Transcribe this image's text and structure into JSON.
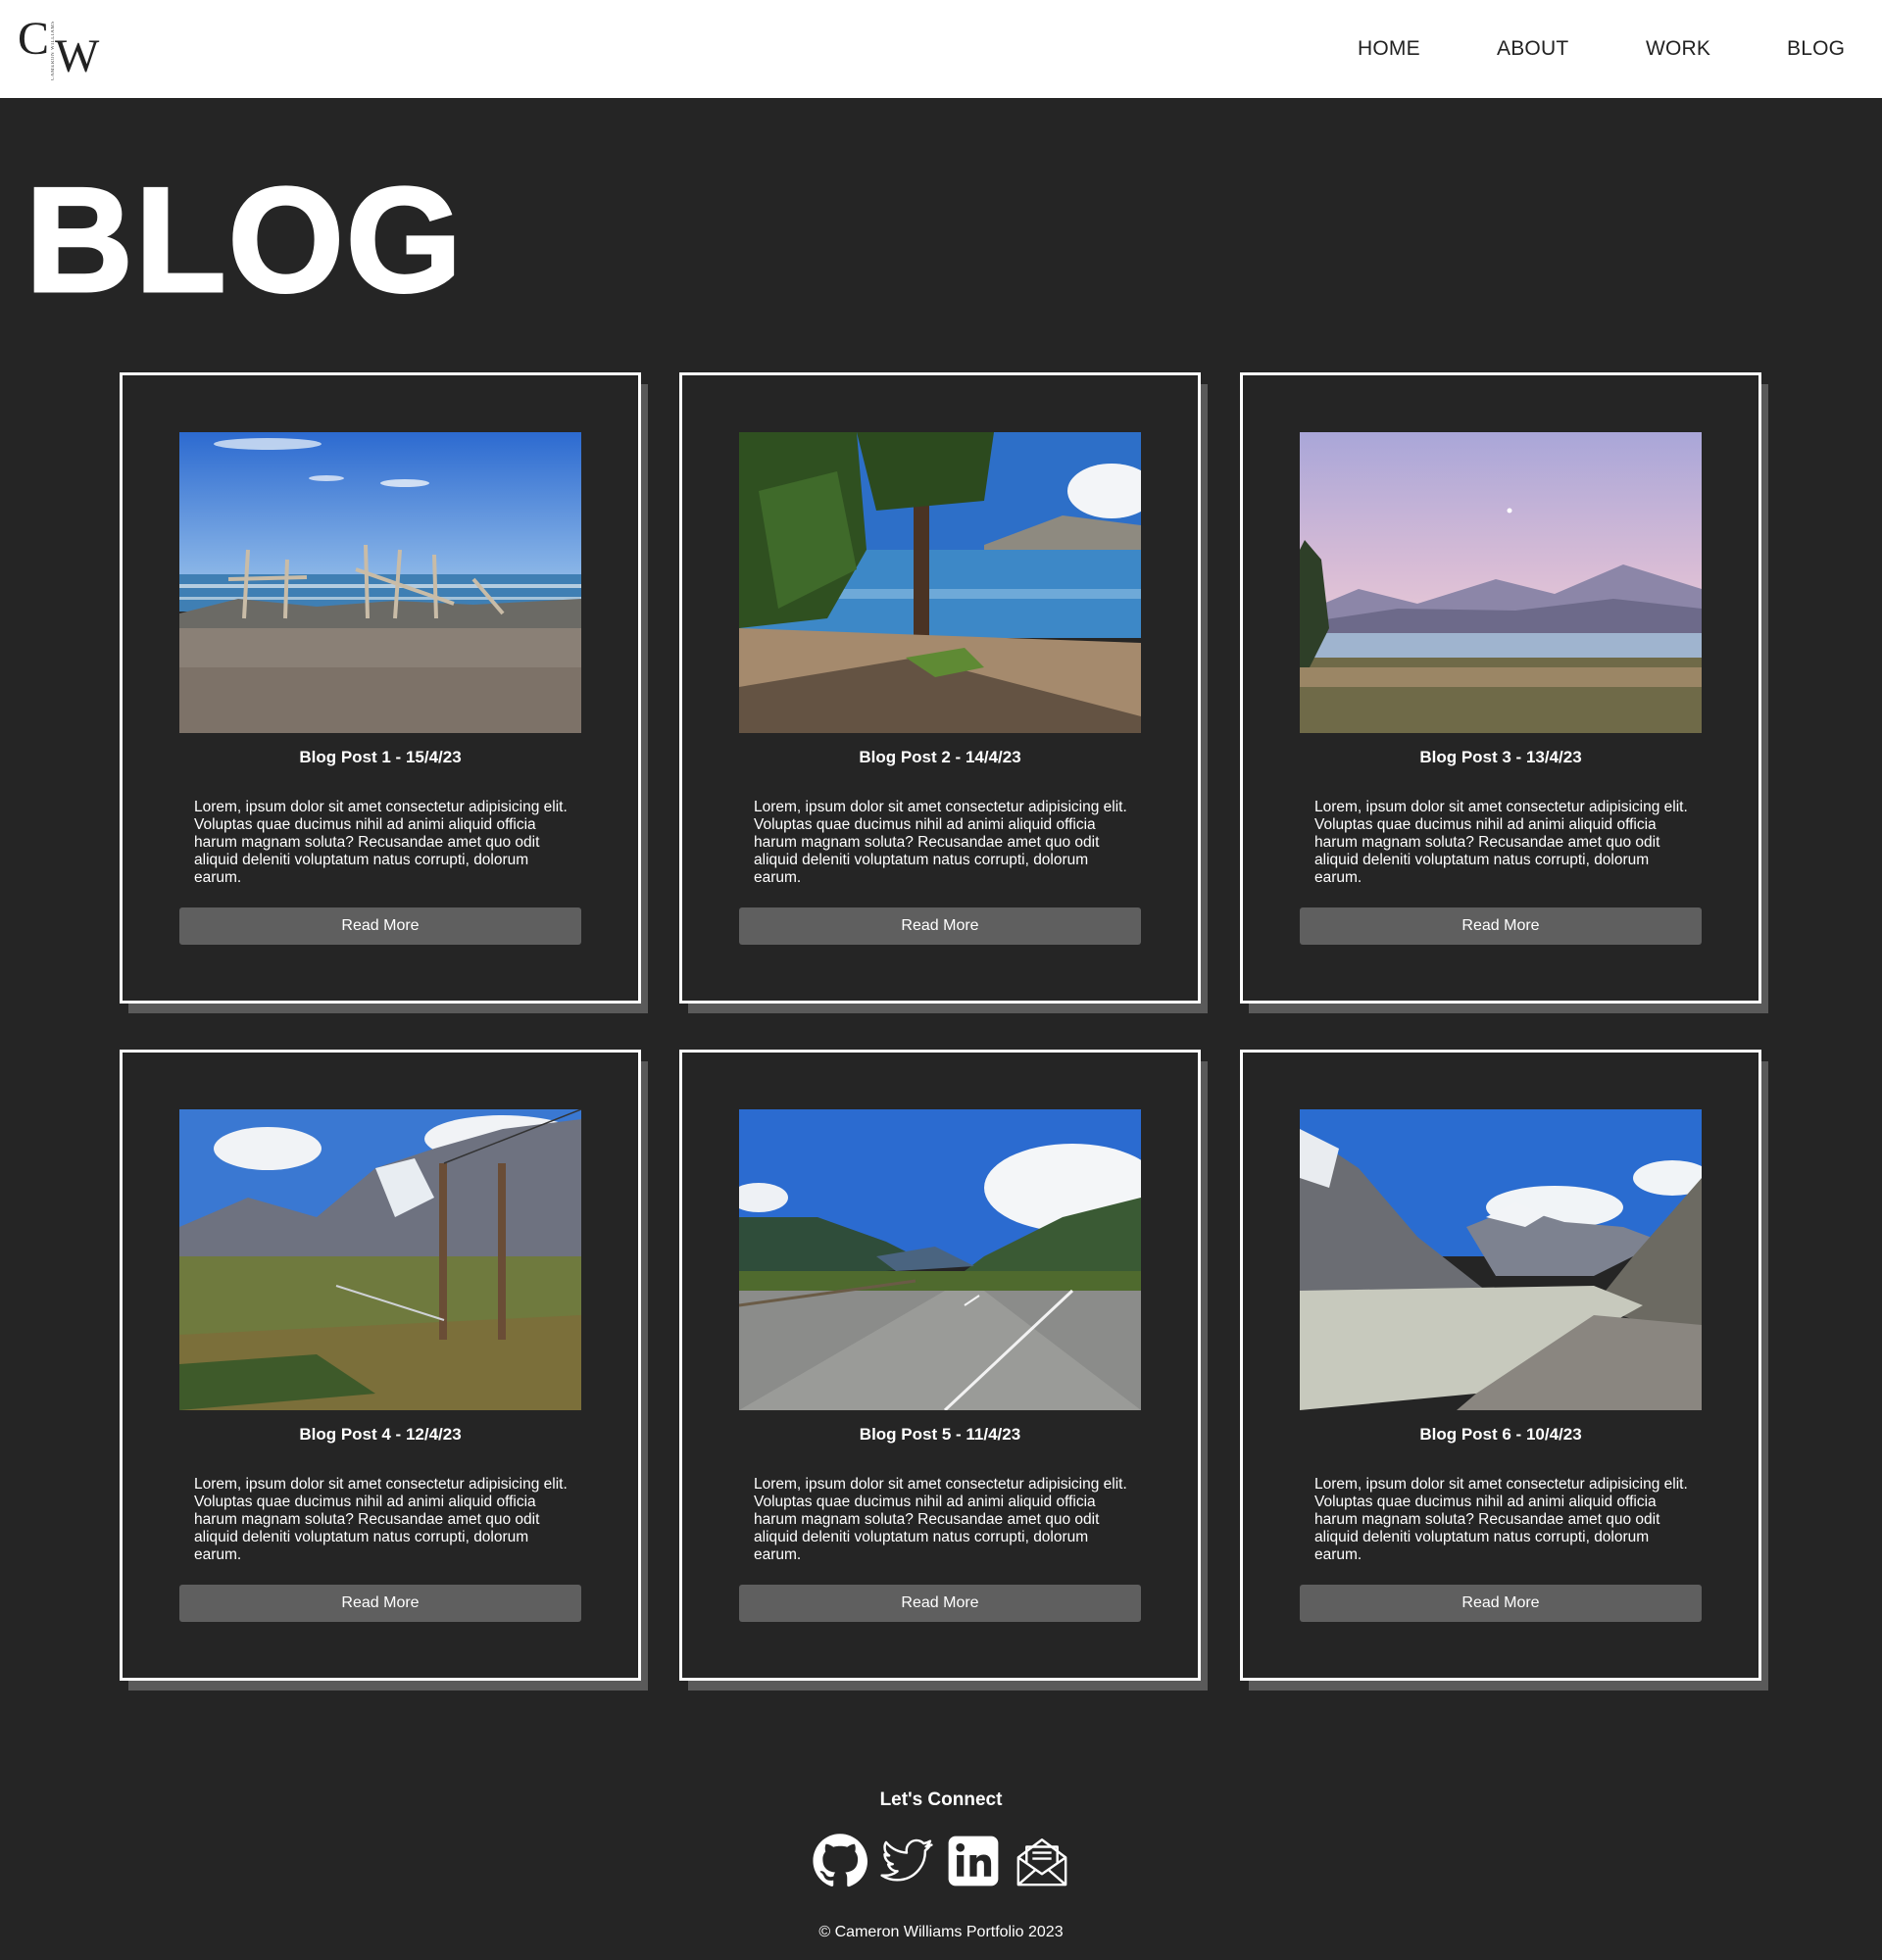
{
  "header": {
    "logo": {
      "letter_c": "C",
      "letter_w": "W",
      "tagline": "CAMERON WILLIAMS"
    },
    "nav": [
      {
        "label": "HOME"
      },
      {
        "label": "ABOUT"
      },
      {
        "label": "WORK"
      },
      {
        "label": "BLOG"
      }
    ]
  },
  "main": {
    "title": "BLOG",
    "posts": [
      {
        "title": "Blog Post 1 - 15/4/23",
        "image": "beach-driftwood-image",
        "body": "Lorem, ipsum dolor sit amet consectetur adipisicing elit. Voluptas quae ducimus nihil ad animi aliquid officia harum magnam soluta? Recusandae amet quo odit aliquid deleniti voluptatum natus corrupti, dolorum earum.",
        "button": "Read More"
      },
      {
        "title": "Blog Post 2 - 14/4/23",
        "image": "lakeside-pine-image",
        "body": "Lorem, ipsum dolor sit amet consectetur adipisicing elit. Voluptas quae ducimus nihil ad animi aliquid officia harum magnam soluta? Recusandae amet quo odit aliquid deleniti voluptatum natus corrupti, dolorum earum.",
        "button": "Read More"
      },
      {
        "title": "Blog Post 3 - 13/4/23",
        "image": "dusk-lake-mountains-image",
        "body": "Lorem, ipsum dolor sit amet consectetur adipisicing elit. Voluptas quae ducimus nihil ad animi aliquid officia harum magnam soluta? Recusandae amet quo odit aliquid deleniti voluptatum natus corrupti, dolorum earum.",
        "button": "Read More"
      },
      {
        "title": "Blog Post 4 - 12/4/23",
        "image": "swing-bridge-valley-image",
        "body": "Lorem, ipsum dolor sit amet consectetur adipisicing elit. Voluptas quae ducimus nihil ad animi aliquid officia harum magnam soluta? Recusandae amet quo odit aliquid deleniti voluptatum natus corrupti, dolorum earum.",
        "button": "Read More"
      },
      {
        "title": "Blog Post 5 - 11/4/23",
        "image": "mountain-road-image",
        "body": "Lorem, ipsum dolor sit amet consectetur adipisicing elit. Voluptas quae ducimus nihil ad animi aliquid officia harum magnam soluta? Recusandae amet quo odit aliquid deleniti voluptatum natus corrupti, dolorum earum.",
        "button": "Read More"
      },
      {
        "title": "Blog Post 6 - 10/4/23",
        "image": "glacier-lake-image",
        "body": "Lorem, ipsum dolor sit amet consectetur adipisicing elit. Voluptas quae ducimus nihil ad animi aliquid officia harum magnam soluta? Recusandae amet quo odit aliquid deleniti voluptatum natus corrupti, dolorum earum.",
        "button": "Read More"
      }
    ]
  },
  "footer": {
    "title": "Let's Connect",
    "social": [
      {
        "icon": "github-icon"
      },
      {
        "icon": "twitter-icon"
      },
      {
        "icon": "linkedin-icon"
      },
      {
        "icon": "mail-icon"
      }
    ],
    "copyright": "© Cameron Williams Portfolio 2023"
  },
  "colors": {
    "background": "#252525",
    "header_bg": "#ffffff",
    "card_border": "#ffffff",
    "card_shadow": "#5a5a5a",
    "button_bg": "#5f5f5f",
    "text": "#ffffff",
    "nav_text": "#222222"
  }
}
